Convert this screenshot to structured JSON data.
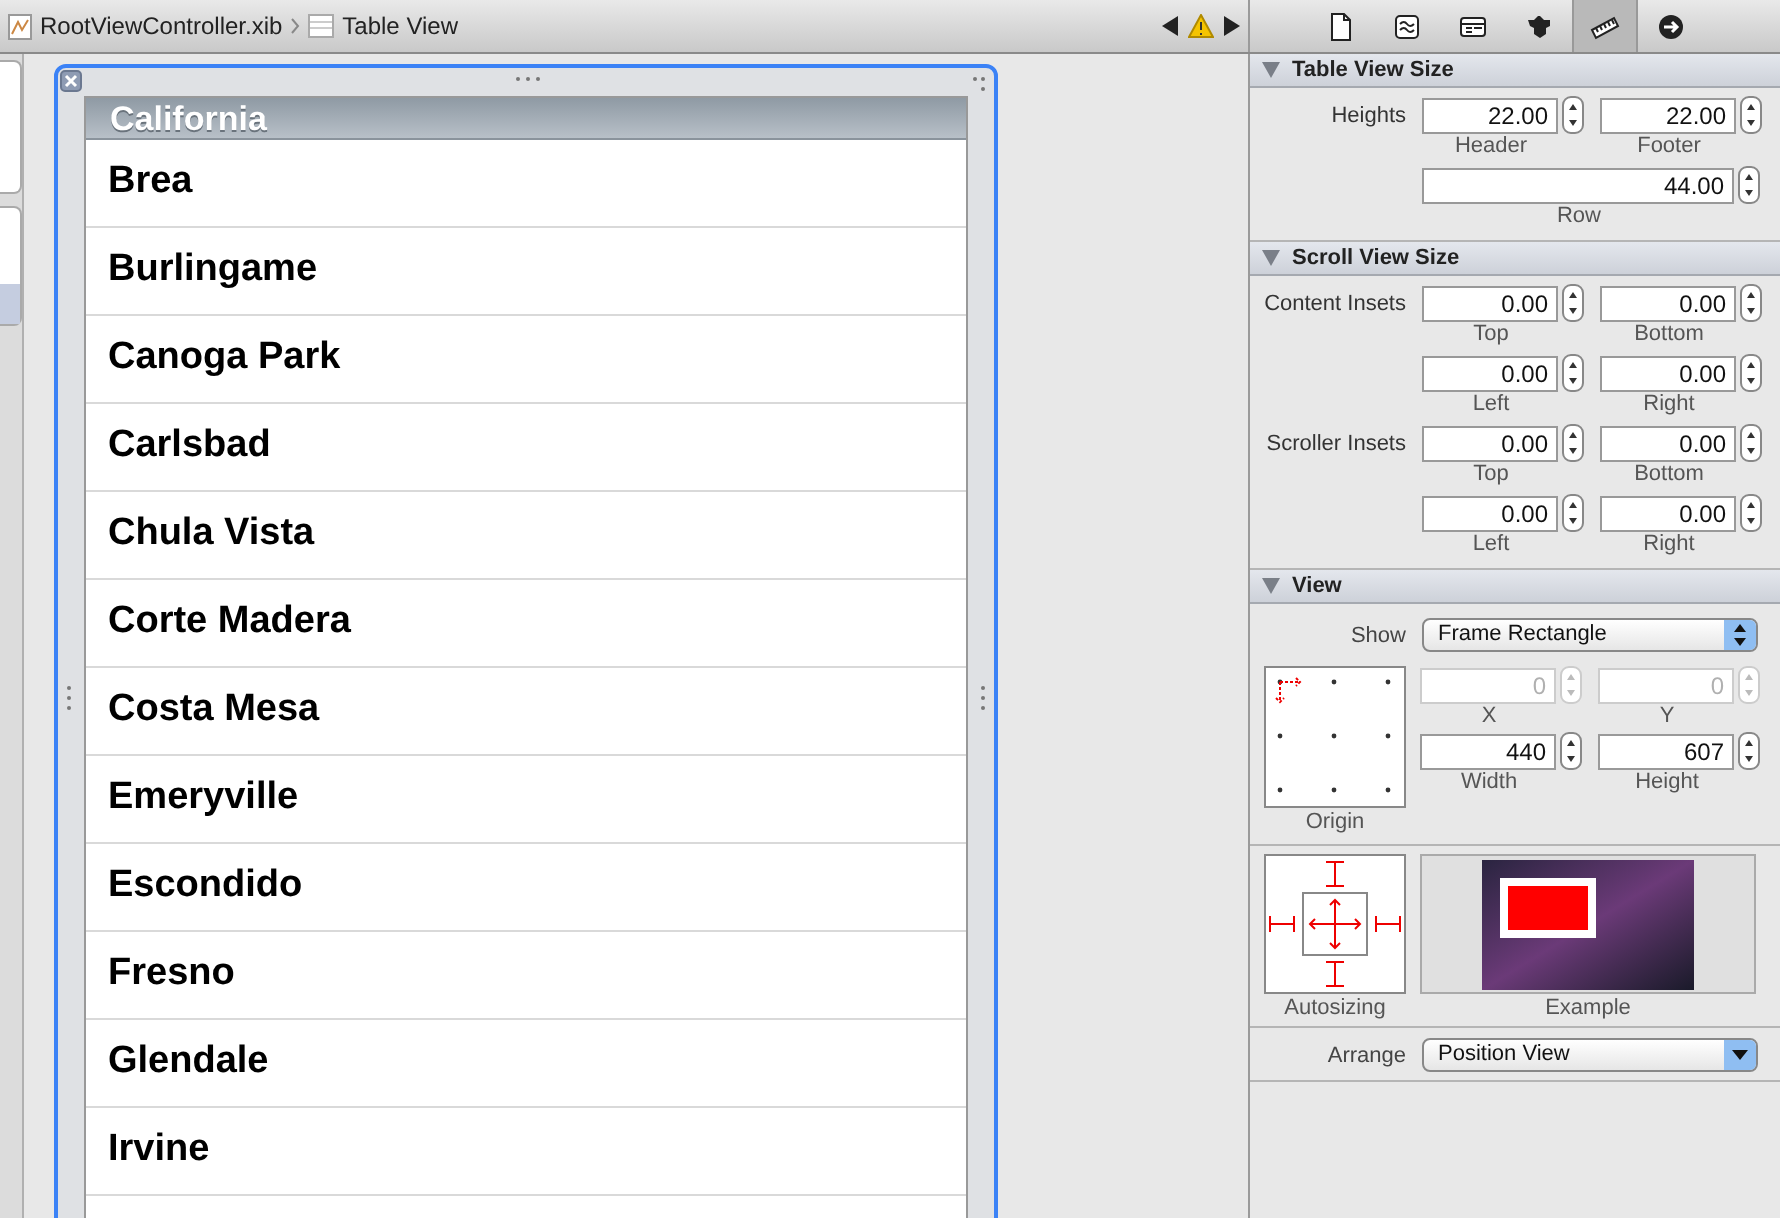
{
  "jump_bar": {
    "file": "RootViewController.xib",
    "item": "Table View",
    "warning": true
  },
  "inspector_tabs": [
    {
      "kind": "file",
      "selected": false
    },
    {
      "kind": "help",
      "selected": false
    },
    {
      "kind": "identity",
      "selected": false
    },
    {
      "kind": "attributes",
      "selected": false
    },
    {
      "kind": "size",
      "selected": true
    },
    {
      "kind": "connections",
      "selected": false
    }
  ],
  "table": {
    "section_header": "California",
    "rows": [
      "Brea",
      "Burlingame",
      "Canoga Park",
      "Carlsbad",
      "Chula Vista",
      "Corte Madera",
      "Costa Mesa",
      "Emeryville",
      "Escondido",
      "Fresno",
      "Glendale",
      "Irvine"
    ]
  },
  "sections": [
    {
      "title": "Table View Size",
      "expanded": true,
      "rows": [
        {
          "label": "Heights",
          "fields": [
            {
              "value": "22.00",
              "caption": "Header",
              "disabled": false
            },
            {
              "value": "22.00",
              "caption": "Footer",
              "disabled": false
            }
          ]
        },
        {
          "fields": [
            {
              "value": "44.00",
              "caption": "Row",
              "disabled": false
            }
          ]
        }
      ]
    },
    {
      "title": "Scroll View Size",
      "expanded": true,
      "rows": [
        {
          "label": "Content Insets",
          "fields": [
            {
              "value": "0.00",
              "caption": "Top",
              "disabled": false
            },
            {
              "value": "0.00",
              "caption": "Bottom",
              "disabled": false
            }
          ]
        },
        {
          "fields": [
            {
              "value": "0.00",
              "caption": "Left",
              "disabled": false
            },
            {
              "value": "0.00",
              "caption": "Right",
              "disabled": false
            }
          ]
        },
        {
          "label": "Scroller Insets",
          "fields": [
            {
              "value": "0.00",
              "caption": "Top",
              "disabled": false
            },
            {
              "value": "0.00",
              "caption": "Bottom",
              "disabled": false
            }
          ]
        },
        {
          "fields": [
            {
              "value": "0.00",
              "caption": "Left",
              "disabled": false
            },
            {
              "value": "0.00",
              "caption": "Right",
              "disabled": false
            }
          ]
        }
      ]
    }
  ],
  "view_section": {
    "title": "View",
    "expanded": true,
    "show": {
      "label": "Show",
      "value": "Frame Rectangle"
    },
    "origin_caption": "Origin",
    "frame_rows": [
      {
        "fields": [
          {
            "value": "0",
            "caption": "X",
            "disabled": true
          },
          {
            "value": "0",
            "caption": "Y",
            "disabled": true
          }
        ]
      },
      {
        "fields": [
          {
            "value": "440",
            "caption": "Width",
            "disabled": false
          },
          {
            "value": "607",
            "caption": "Height",
            "disabled": false
          }
        ]
      }
    ],
    "autosizing_caption": "Autosizing",
    "example_caption": "Example",
    "arrange": {
      "label": "Arrange",
      "value": "Position View"
    }
  }
}
